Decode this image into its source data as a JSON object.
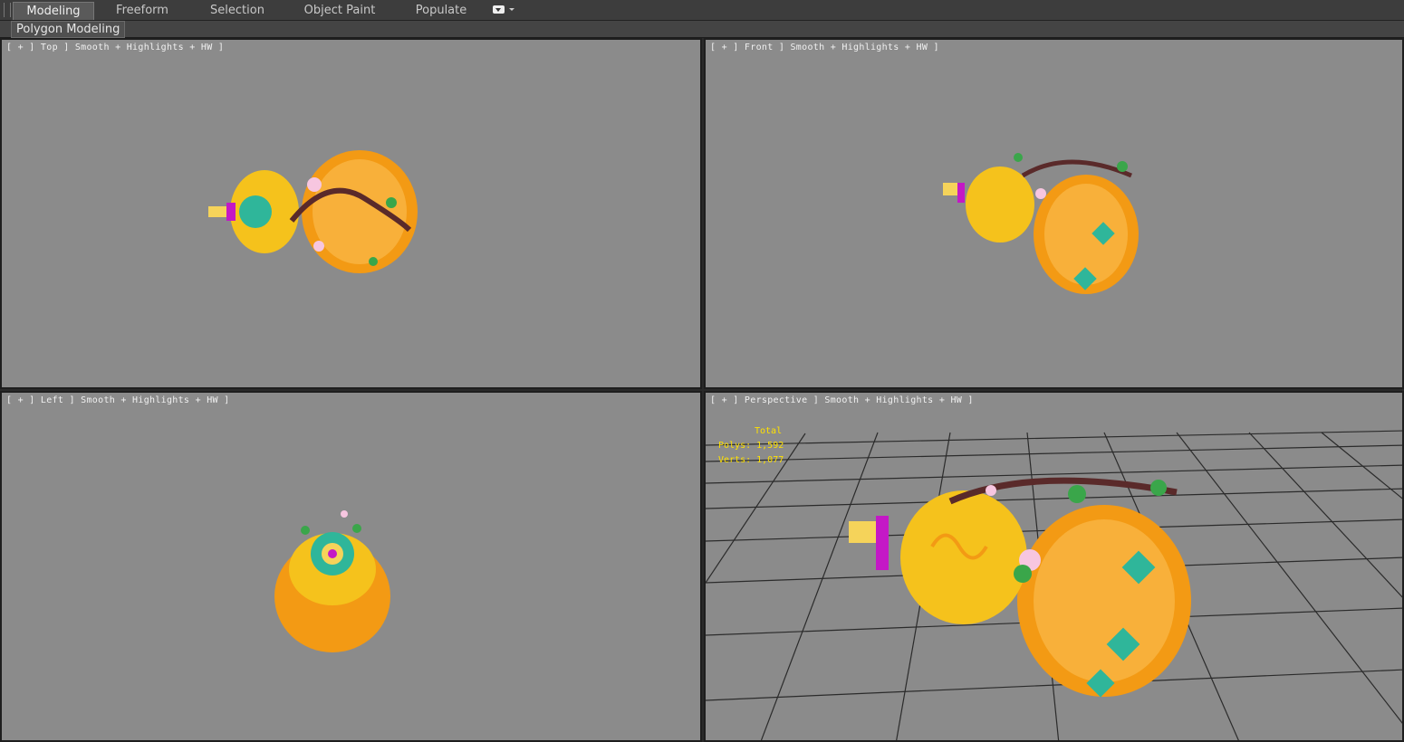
{
  "ribbon": {
    "tabs": [
      {
        "label": "Modeling",
        "active": true
      },
      {
        "label": "Freeform",
        "active": false
      },
      {
        "label": "Selection",
        "active": false
      },
      {
        "label": "Object Paint",
        "active": false
      },
      {
        "label": "Populate",
        "active": false
      }
    ],
    "options_icon": "dropdown-options-icon",
    "panel_label": "Polygon Modeling"
  },
  "viewports": {
    "top": {
      "label": "[ + ] Top ] Smooth + Highlights + HW ]"
    },
    "front": {
      "label": "[ + ] Front ] Smooth + Highlights + HW ]"
    },
    "left": {
      "label": "[ + ] Left ] Smooth + Highlights + HW ]"
    },
    "perspective": {
      "label": "[ + ] Perspective ] Smooth + Highlights + HW ]",
      "stats": {
        "title": "Total",
        "polys": "Polys: 1,592",
        "verts": "Verts: 1,077"
      }
    }
  },
  "colors": {
    "viewport_bg": "#8b8b8b",
    "gourd_orange": "#f39a14",
    "gourd_gold": "#f5c21c",
    "stats_yellow": "#ffe100",
    "ribbon_bg": "#3d3d3d"
  }
}
